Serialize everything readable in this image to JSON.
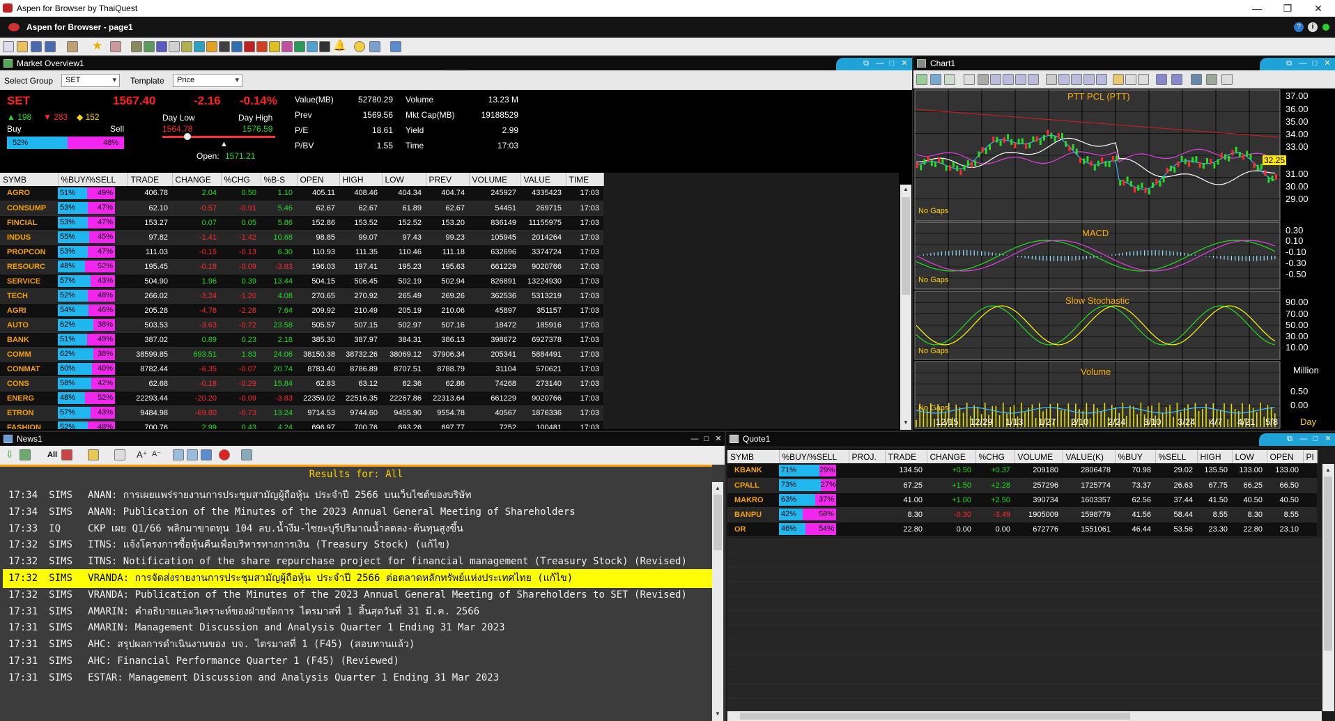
{
  "window": {
    "title": "Aspen for Browser by ThaiQuest"
  },
  "app": {
    "title": "Aspen for Browser  - page1"
  },
  "market_overview": {
    "panel_title": "Market Overview1",
    "select_group_label": "Select Group",
    "select_group_value": "SET",
    "template_label": "Template",
    "template_value": "Price",
    "index": {
      "name": "SET",
      "last": "1567.40",
      "change": "-2.16",
      "pct": "-0.14%",
      "up": "▲ 198",
      "down": "▼ 283",
      "unch": "◆ 152",
      "buy_label": "Buy",
      "sell_label": "Sell",
      "buy_pct": "52%",
      "sell_pct": "48%",
      "buy_fraction": 0.52,
      "day_low_label": "Day Low",
      "day_low": "1564.78",
      "day_high_label": "Day High",
      "day_high": "1576.59",
      "open_label": "Open:",
      "open": "1571.21",
      "value_label": "Value(MB)",
      "value": "52780.29",
      "prev_label": "Prev",
      "prev": "1569.56",
      "pe_label": "P/E",
      "pe": "18.61",
      "pbv_label": "P/BV",
      "pbv": "1.55",
      "volume_label": "Volume",
      "volume": "13.23 M",
      "mktcap_label": "Mkt Cap(MB)",
      "mktcap": "19188529",
      "yield_label": "Yield",
      "yield": "2.99",
      "time_label": "Time",
      "time": "17:03"
    },
    "columns": [
      "SYMB",
      "%BUY/%SELL",
      "TRADE",
      "CHANGE",
      "%CHG",
      "%B-S",
      "OPEN",
      "HIGH",
      "LOW",
      "PREV",
      "VOLUME",
      "VALUE",
      "TIME"
    ],
    "rows": [
      {
        "sym": "AGRO",
        "buy": "51%",
        "sell": "49%",
        "trade": "406.78",
        "chg": "2.04",
        "pchg": "0.50",
        "bs": "1.10",
        "open": "405.11",
        "high": "408.46",
        "low": "404.34",
        "prev": "404.74",
        "vol": "245927",
        "val": "4335423",
        "time": "17:03",
        "dir": "up"
      },
      {
        "sym": "CONSUMP",
        "buy": "53%",
        "sell": "47%",
        "trade": "62.10",
        "chg": "-0.57",
        "pchg": "-0.91",
        "bs": "5.46",
        "open": "62.67",
        "high": "62.67",
        "low": "61.89",
        "prev": "62.67",
        "vol": "54451",
        "val": "269715",
        "time": "17:03",
        "dir": "down"
      },
      {
        "sym": "FINCIAL",
        "buy": "53%",
        "sell": "47%",
        "trade": "153.27",
        "chg": "0.07",
        "pchg": "0.05",
        "bs": "5.86",
        "open": "152.86",
        "high": "153.52",
        "low": "152.52",
        "prev": "153.20",
        "vol": "836149",
        "val": "11155975",
        "time": "17:03",
        "dir": "up"
      },
      {
        "sym": "INDUS",
        "buy": "55%",
        "sell": "45%",
        "trade": "97.82",
        "chg": "-1.41",
        "pchg": "-1.42",
        "bs": "10.68",
        "open": "98.85",
        "high": "99.07",
        "low": "97.43",
        "prev": "99.23",
        "vol": "105945",
        "val": "2014264",
        "time": "17:03",
        "dir": "down"
      },
      {
        "sym": "PROPCON",
        "buy": "53%",
        "sell": "47%",
        "trade": "111.03",
        "chg": "-0.15",
        "pchg": "-0.13",
        "bs": "6.30",
        "open": "110.93",
        "high": "111.35",
        "low": "110.46",
        "prev": "111.18",
        "vol": "632696",
        "val": "3374724",
        "time": "17:03",
        "dir": "down"
      },
      {
        "sym": "RESOURC",
        "buy": "48%",
        "sell": "52%",
        "trade": "195.45",
        "chg": "-0.18",
        "pchg": "-0.09",
        "bs": "-3.83",
        "open": "196.03",
        "high": "197.41",
        "low": "195.23",
        "prev": "195.63",
        "vol": "661229",
        "val": "9020766",
        "time": "17:03",
        "dir": "down"
      },
      {
        "sym": "SERVICE",
        "buy": "57%",
        "sell": "43%",
        "trade": "504.90",
        "chg": "1.96",
        "pchg": "0.39",
        "bs": "13.44",
        "open": "504.15",
        "high": "506.45",
        "low": "502.19",
        "prev": "502.94",
        "vol": "826891",
        "val": "13224930",
        "time": "17:03",
        "dir": "up"
      },
      {
        "sym": "TECH",
        "buy": "52%",
        "sell": "48%",
        "trade": "266.02",
        "chg": "-3.24",
        "pchg": "-1.20",
        "bs": "4.08",
        "open": "270.65",
        "high": "270.92",
        "low": "265.49",
        "prev": "269.26",
        "vol": "362536",
        "val": "5313219",
        "time": "17:03",
        "dir": "down"
      },
      {
        "sym": "AGRI",
        "buy": "54%",
        "sell": "46%",
        "trade": "205.28",
        "chg": "-4.78",
        "pchg": "-2.28",
        "bs": "7.64",
        "open": "209.92",
        "high": "210.49",
        "low": "205.19",
        "prev": "210.06",
        "vol": "45897",
        "val": "351157",
        "time": "17:03",
        "dir": "down"
      },
      {
        "sym": "AUTO",
        "buy": "62%",
        "sell": "38%",
        "trade": "503.53",
        "chg": "-3.63",
        "pchg": "-0.72",
        "bs": "23.58",
        "open": "505.57",
        "high": "507.15",
        "low": "502.97",
        "prev": "507.16",
        "vol": "18472",
        "val": "185916",
        "time": "17:03",
        "dir": "down"
      },
      {
        "sym": "BANK",
        "buy": "51%",
        "sell": "49%",
        "trade": "387.02",
        "chg": "0.89",
        "pchg": "0.23",
        "bs": "2.18",
        "open": "385.30",
        "high": "387.97",
        "low": "384.31",
        "prev": "386.13",
        "vol": "398672",
        "val": "6927378",
        "time": "17:03",
        "dir": "up"
      },
      {
        "sym": "COMM",
        "buy": "62%",
        "sell": "38%",
        "trade": "38599.85",
        "chg": "693.51",
        "pchg": "1.83",
        "bs": "24.06",
        "open": "38150.38",
        "high": "38732.26",
        "low": "38069.12",
        "prev": "37906.34",
        "vol": "205341",
        "val": "5884491",
        "time": "17:03",
        "dir": "up"
      },
      {
        "sym": "CONMAT",
        "buy": "60%",
        "sell": "40%",
        "trade": "8782.44",
        "chg": "-6.35",
        "pchg": "-0.07",
        "bs": "20.74",
        "open": "8783.40",
        "high": "8786.89",
        "low": "8707.51",
        "prev": "8788.79",
        "vol": "31104",
        "val": "570621",
        "time": "17:03",
        "dir": "down"
      },
      {
        "sym": "CONS",
        "buy": "58%",
        "sell": "42%",
        "trade": "62.68",
        "chg": "-0.18",
        "pchg": "-0.29",
        "bs": "15.84",
        "open": "62.83",
        "high": "63.12",
        "low": "62.36",
        "prev": "62.86",
        "vol": "74268",
        "val": "273140",
        "time": "17:03",
        "dir": "down"
      },
      {
        "sym": "ENERG",
        "buy": "48%",
        "sell": "52%",
        "trade": "22293.44",
        "chg": "-20.20",
        "pchg": "-0.09",
        "bs": "-3.83",
        "open": "22359.02",
        "high": "22516.35",
        "low": "22267.86",
        "prev": "22313.64",
        "vol": "661229",
        "val": "9020766",
        "time": "17:03",
        "dir": "down"
      },
      {
        "sym": "ETRON",
        "buy": "57%",
        "sell": "43%",
        "trade": "9484.98",
        "chg": "-69.80",
        "pchg": "-0.73",
        "bs": "13.24",
        "open": "9714.53",
        "high": "9744.60",
        "low": "9455.90",
        "prev": "9554.78",
        "vol": "40567",
        "val": "1876336",
        "time": "17:03",
        "dir": "down"
      },
      {
        "sym": "FASHION",
        "buy": "52%",
        "sell": "48%",
        "trade": "700.76",
        "chg": "2.99",
        "pchg": "0.43",
        "bs": "4.24",
        "open": "696.97",
        "high": "700.76",
        "low": "693.26",
        "prev": "697.77",
        "vol": "7252",
        "val": "100481",
        "time": "17:03",
        "dir": "up"
      }
    ]
  },
  "chart": {
    "panel_title": "Chart1",
    "price_title": "PTT PCL (PTT)",
    "last_label": "32.25",
    "macd_title": "MACD",
    "stoch_title": "Slow Stochastic",
    "volume_title": "Volume",
    "no_gaps": "No Gaps",
    "price_axis": [
      "37.00",
      "36.00",
      "35.00",
      "34.00",
      "33.00",
      "31.00",
      "30.00",
      "29.00"
    ],
    "macd_axis": [
      "0.30",
      "0.10",
      "-0.10",
      "-0.30",
      "-0.50"
    ],
    "stoch_axis": [
      "90.00",
      "70.00",
      "50.00",
      "30.00",
      "10.00"
    ],
    "volume_unit": "Million",
    "volume_axis": [
      "0.50",
      "0.00"
    ],
    "x_axis": [
      "12/15",
      "12/29",
      "1/13",
      "1/27",
      "2/10",
      "2/24",
      "3/10",
      "3/24",
      "4/7",
      "4/21",
      "5/8"
    ],
    "x_unit": "Day"
  },
  "news": {
    "panel_title": "News1",
    "all_label": "All",
    "results": "Results for: All",
    "items": [
      {
        "time": "17:34",
        "src": "SIMS",
        "text": "ANAN: การเผยแพร่รายงานการประชุมสามัญผู้ถือหุ้น ประจำปี 2566 บนเว็บไซต์ของบริษัท"
      },
      {
        "time": "17:34",
        "src": "SIMS",
        "text": "ANAN: Publication of the Minutes of the 2023 Annual General Meeting of Shareholders"
      },
      {
        "time": "17:33",
        "src": "IQ",
        "text": "CKP เผย Q1/66 พลิกมาขาดทุน 104 ลบ.น้ำงึม-ไซยะบุรีปริมาณน้ำลดลง-ต้นทุนสูงขึ้น"
      },
      {
        "time": "17:32",
        "src": "SIMS",
        "text": "ITNS: แจ้งโครงการซื้อหุ้นคืนเพื่อบริหารทางการเงิน (Treasury Stock) (แก้ไข)"
      },
      {
        "time": "17:32",
        "src": "SIMS",
        "text": "ITNS: Notification of the share repurchase project for financial management (Treasury Stock) (Revised)"
      },
      {
        "time": "17:32",
        "src": "SIMS",
        "text": "VRANDA: การจัดส่งรายงานการประชุมสามัญผู้ถือหุ้น ประจำปี 2566 ต่อตลาดหลักทรัพย์แห่งประเทศไทย (แก้ไข)"
      },
      {
        "time": "17:32",
        "src": "SIMS",
        "text": "VRANDA: Publication of the Minutes of the 2023 Annual General Meeting of Shareholders to SET (Revised)"
      },
      {
        "time": "17:31",
        "src": "SIMS",
        "text": "AMARIN: คำอธิบายและวิเคราะห์ของฝ่ายจัดการ ไตรมาสที่ 1 สิ้นสุดวันที่ 31 มี.ค. 2566"
      },
      {
        "time": "17:31",
        "src": "SIMS",
        "text": "AMARIN: Management Discussion and Analysis Quarter 1 Ending 31 Mar 2023"
      },
      {
        "time": "17:31",
        "src": "SIMS",
        "text": "AHC: สรุปผลการดำเนินงานของ บจ. ไตรมาสที่ 1 (F45) (สอบทานแล้ว)"
      },
      {
        "time": "17:31",
        "src": "SIMS",
        "text": "AHC: Financial Performance Quarter 1 (F45) (Reviewed)"
      },
      {
        "time": "17:31",
        "src": "SIMS",
        "text": "ESTAR: Management Discussion and Analysis Quarter 1 Ending 31 Mar 2023"
      }
    ]
  },
  "quote": {
    "panel_title": "Quote1",
    "columns": [
      "SYMB",
      "%BUY/%SELL",
      "PROJ.",
      "TRADE",
      "CHANGE",
      "%CHG",
      "VOLUME",
      "VALUE(K)",
      "%BUY",
      "%SELL",
      "HIGH",
      "LOW",
      "OPEN",
      "PI"
    ],
    "rows": [
      {
        "sym": "KBANK",
        "buy": "71%",
        "sell": "29%",
        "proj": "",
        "trade": "134.50",
        "chg": "+0.50",
        "pchg": "+0.37",
        "vol": "209180",
        "val": "2806478",
        "pbuy": "70.98",
        "psell": "29.02",
        "high": "135.50",
        "low": "133.00",
        "open": "133.00",
        "dir": "up"
      },
      {
        "sym": "CPALL",
        "buy": "73%",
        "sell": "27%",
        "proj": "",
        "trade": "67.25",
        "chg": "+1.50",
        "pchg": "+2.28",
        "vol": "257296",
        "val": "1725774",
        "pbuy": "73.37",
        "psell": "26.63",
        "high": "67.75",
        "low": "66.25",
        "open": "66.50",
        "dir": "up"
      },
      {
        "sym": "MAKRO",
        "buy": "63%",
        "sell": "37%",
        "proj": "",
        "trade": "41.00",
        "chg": "+1.00",
        "pchg": "+2.50",
        "vol": "390734",
        "val": "1603357",
        "pbuy": "62.56",
        "psell": "37.44",
        "high": "41.50",
        "low": "40.50",
        "open": "40.50",
        "dir": "up"
      },
      {
        "sym": "BANPU",
        "buy": "42%",
        "sell": "58%",
        "proj": "",
        "trade": "8.30",
        "chg": "-0.30",
        "pchg": "-3.49",
        "vol": "1905009",
        "val": "1598779",
        "pbuy": "41.56",
        "psell": "58.44",
        "high": "8.55",
        "low": "8.30",
        "open": "8.55",
        "dir": "down"
      },
      {
        "sym": "OR",
        "buy": "46%",
        "sell": "54%",
        "proj": "",
        "trade": "22.80",
        "chg": "0.00",
        "pchg": "0.00",
        "vol": "672776",
        "val": "1551061",
        "pbuy": "46.44",
        "psell": "53.56",
        "high": "23.30",
        "low": "22.80",
        "open": "23.10",
        "dir": "flat"
      }
    ]
  },
  "colors": {
    "buy": "#20b7f0",
    "sell": "#f326f0",
    "up": "#22dd22",
    "down": "#ff2a2a",
    "symbol": "#f4a000",
    "accent_tab": "#1fa3d6",
    "highlight": "#ffff00"
  }
}
